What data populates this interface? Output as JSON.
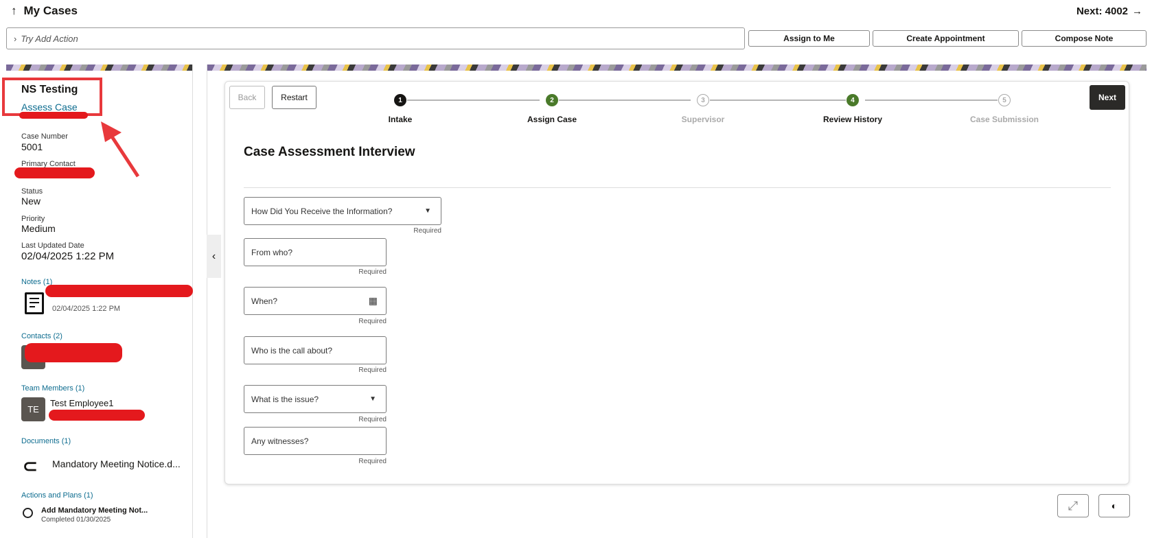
{
  "header": {
    "back_arrow": "↑",
    "title": "My Cases",
    "next_label": "Next: 4002",
    "next_arrow": "→"
  },
  "action_bar": {
    "placeholder": "Try Add Action",
    "buttons": [
      "Assign to Me",
      "Create Appointment",
      "Compose Note"
    ]
  },
  "summary": {
    "case_name": "NS Testing",
    "case_stage": "Assess Case",
    "fields": [
      {
        "label": "Case Number",
        "value": "5001"
      },
      {
        "label": "Primary Contact",
        "value": ""
      },
      {
        "label": "Status",
        "value": "New"
      },
      {
        "label": "Priority",
        "value": "Medium"
      },
      {
        "label": "Last Updated Date",
        "value": "02/04/2025 1:22 PM"
      }
    ],
    "notes": {
      "title": "Notes (1)",
      "date": "02/04/2025 1:22 PM"
    },
    "contacts": {
      "title": "Contacts (2)"
    },
    "team": {
      "title": "Team Members (1)",
      "initials": "TE",
      "name": "Test Employee1"
    },
    "documents": {
      "title": "Documents (1)",
      "name": "Mandatory Meeting Notice.d..."
    },
    "actions": {
      "title": "Actions and Plans (1)",
      "name": "Add Mandatory Meeting Not...",
      "status": "Completed 01/30/2025"
    }
  },
  "wizard": {
    "back": "Back",
    "restart": "Restart",
    "next": "Next",
    "steps": [
      {
        "num": "1",
        "label": "Intake",
        "color": "#161513"
      },
      {
        "num": "2",
        "label": "Assign Case",
        "color": "#4a7a2a"
      },
      {
        "num": "3",
        "label": "Supervisor",
        "color": "#aaaaaa"
      },
      {
        "num": "4",
        "label": "Review History",
        "color": "#4a7a2a"
      },
      {
        "num": "5",
        "label": "Case Submission",
        "color": "#aaaaaa"
      }
    ],
    "title": "Case Assessment Interview",
    "fields": [
      {
        "label": "How Did You Receive the Information?",
        "type": "select",
        "hint": "Required"
      },
      {
        "label": "From who?",
        "type": "text",
        "hint": "Required"
      },
      {
        "label": "When?",
        "type": "date",
        "hint": "Required"
      },
      {
        "label": "Who is the call about?",
        "type": "text",
        "hint": "Required"
      },
      {
        "label": "What is the issue?",
        "type": "select",
        "hint": "Required"
      },
      {
        "label": "Any witnesses?",
        "type": "text",
        "hint": "Required"
      }
    ]
  }
}
